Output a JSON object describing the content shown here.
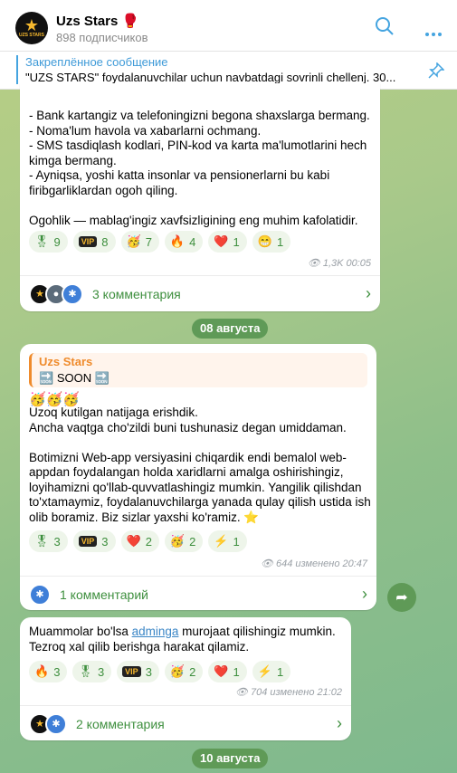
{
  "channel": {
    "title": "Uzs Stars 🥊",
    "subscribers": "898 подписчиков",
    "avatar_text": "UZS STARS"
  },
  "pinned": {
    "title": "Закреплённое сообщение",
    "text": "\"UZS STARS\" foydalanuvchilar uchun navbatdagi sovrinli chellenj.  30..."
  },
  "post1": {
    "text": "- Bank kartangiz va telefoningizni begona shaxslarga bermang.\n- Noma'lum havola va xabarlarni ochmang.\n- SMS tasdiqlash kodlari, PIN-kod va karta ma'lumotlarini hech kimga bermang.\n- Ayniqsa, yoshi katta insonlar va pensionerlarni bu kabi firibgarliklardan ogoh qiling.\n\nOgohlik — mablag'ingiz xavfsizligining eng muhim kafolatidir.",
    "reactions": [
      {
        "emoji": "🎖",
        "count": "9"
      },
      {
        "emoji": "VIP",
        "count": "8"
      },
      {
        "emoji": "🥳",
        "count": "7"
      },
      {
        "emoji": "🔥",
        "count": "4"
      },
      {
        "emoji": "❤️",
        "count": "1"
      },
      {
        "emoji": "😁",
        "count": "1"
      }
    ],
    "views": "1,3K",
    "time": "00:05",
    "comments": "3 комментария"
  },
  "date1": "08 августа",
  "post2": {
    "reply_author": "Uzs Stars",
    "reply_text": "SOON",
    "text": "Uzoq kutilgan natijaga erishdik.\nAncha vaqtga cho'zildi buni tushunasiz degan umiddaman.\n\nBotimizni Web-app versiyasini chiqardik endi bemalol web-appdan foydalangan holda xaridlarni amalga oshirishingiz, loyihamizni qo'llab-quvvatlashingiz mumkin. Yangilik qilishdan to'xtamaymiz, foydalanuvchilarga yanada qulay qilish ustida ish olib boramiz. Biz sizlar yaxshi ko'ramiz.",
    "reactions": [
      {
        "emoji": "🎖",
        "count": "3"
      },
      {
        "emoji": "VIP",
        "count": "3"
      },
      {
        "emoji": "❤️",
        "count": "2"
      },
      {
        "emoji": "🥳",
        "count": "2"
      },
      {
        "emoji": "⚡",
        "count": "1"
      }
    ],
    "views": "644",
    "edited": "изменено",
    "time": "20:47",
    "comments": "1 комментарий"
  },
  "post3": {
    "text_before": "Muammolar bo'lsa ",
    "link": "adminga",
    "text_after": " murojaat qilishingiz mumkin.\nTezroq xal qilib berishga harakat qilamiz.",
    "reactions": [
      {
        "emoji": "🔥",
        "count": "3"
      },
      {
        "emoji": "🎖",
        "count": "3"
      },
      {
        "emoji": "VIP",
        "count": "3"
      },
      {
        "emoji": "🥳",
        "count": "2"
      },
      {
        "emoji": "❤️",
        "count": "1"
      },
      {
        "emoji": "⚡",
        "count": "1"
      }
    ],
    "views": "704",
    "edited": "изменено",
    "time": "21:02",
    "comments": "2 комментария"
  },
  "date2": "10 августа"
}
